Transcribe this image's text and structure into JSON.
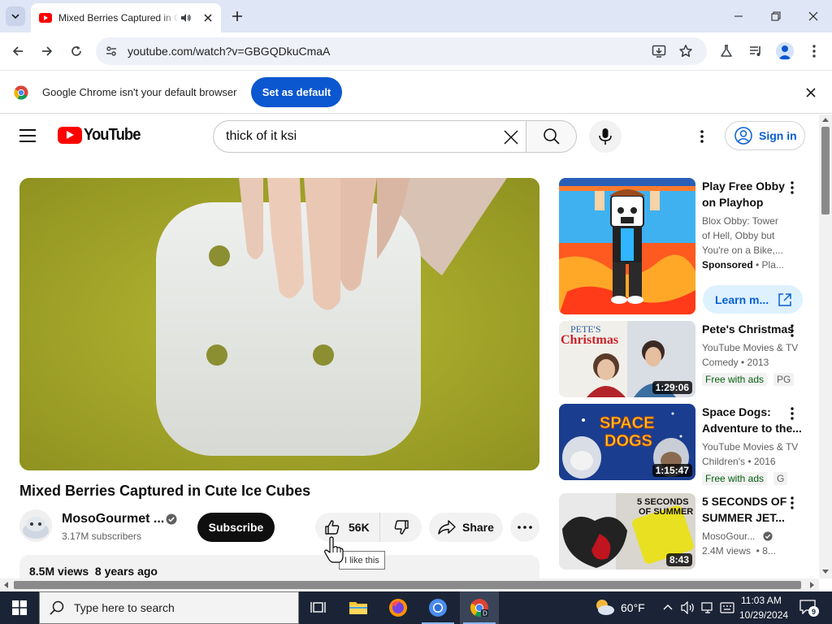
{
  "browser": {
    "tab_title": "Mixed Berries Captured in Cute Ice Cubes",
    "url": "youtube.com/watch?v=GBGQDkuCmaA",
    "infobar_text": "Google Chrome isn't your default browser",
    "infobar_button": "Set as default"
  },
  "youtube": {
    "logo_text": "YouTube",
    "search_value": "thick of it ksi",
    "sign_in": "Sign in"
  },
  "video": {
    "title": "Mixed Berries Captured in Cute Ice Cubes",
    "channel_name": "MosoGourmet ...",
    "subscribers": "3.17M subscribers",
    "subscribe_label": "Subscribe",
    "like_count": "56K",
    "share_label": "Share",
    "tooltip": "I like this",
    "views_date": "8.5M views  8 years ago"
  },
  "sidebar": {
    "items": [
      {
        "title_lines": [
          "Play Free Obby",
          "on Playhop"
        ],
        "meta_lines": [
          "Blox Obby: Tower",
          "of Hell, Obby but",
          "You're on a Bike,..."
        ],
        "sponsored_label": "Sponsored",
        "sponsored_suffix": " • Pla...",
        "learn_more": "Learn m..."
      },
      {
        "title_lines": [
          "Pete's Christmas"
        ],
        "meta_lines": [
          "YouTube Movies & TV",
          "Comedy • 2013"
        ],
        "badge": "Free with ads",
        "rating": "PG",
        "duration": "1:29:06",
        "thumb_text": [
          "PETE'S",
          "Christmas"
        ]
      },
      {
        "title_lines": [
          "Space Dogs:",
          "Adventure to the..."
        ],
        "meta_lines": [
          "YouTube Movies & TV",
          "Children's • 2016"
        ],
        "badge": "Free with ads",
        "rating": "G",
        "duration": "1:15:47",
        "thumb_text": [
          "SPACE",
          "DOGS"
        ]
      },
      {
        "title_lines": [
          "5 SECONDS OF",
          "SUMMER JET..."
        ],
        "meta_lines": [
          "MosoGour...",
          "2.4M views  • 8..."
        ],
        "duration": "8:43",
        "thumb_text": [
          "5 SECONDS",
          "OF SUMMER"
        ]
      }
    ]
  },
  "taskbar": {
    "search_placeholder": "Type here to search",
    "weather": "60°F",
    "time": "11:03 AM",
    "date": "10/29/2024",
    "notification_count": "9"
  }
}
